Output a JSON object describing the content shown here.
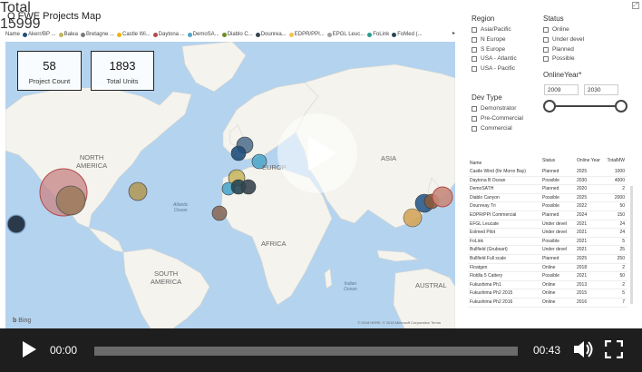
{
  "report": {
    "title": "Q FWE Projects Map",
    "legend_title": "Name",
    "legend_items": [
      {
        "label": "Akerr/BP ...",
        "color": "#1f4e79"
      },
      {
        "label": "Balea",
        "color": "#c5b45a"
      },
      {
        "label": "Bretagne ...",
        "color": "#7a7a7a"
      },
      {
        "label": "Castle Wi...",
        "color": "#f0b400"
      },
      {
        "label": "Daytona ...",
        "color": "#b34a4a"
      },
      {
        "label": "DemoSA...",
        "color": "#4da6c8"
      },
      {
        "label": "Diablo C...",
        "color": "#6b8e23"
      },
      {
        "label": "Dounrea...",
        "color": "#36454f"
      },
      {
        "label": "EDPR/PPI...",
        "color": "#f2c14e"
      },
      {
        "label": "EPGL Leuc...",
        "color": "#a0a0a0"
      },
      {
        "label": "FoLink",
        "color": "#2a9d8f"
      },
      {
        "label": "FoMed (...",
        "color": "#264653"
      }
    ],
    "legend_more": "▸"
  },
  "kpis": [
    {
      "value": "58",
      "label": "Project Count"
    },
    {
      "value": "1893",
      "label": "Total Units"
    }
  ],
  "map": {
    "labels": {
      "north_america": "NORTH\nAMERICA",
      "europe": "EUROP",
      "asia": "ASIA",
      "africa": "AFRICA",
      "south_america": "SOUTH\nAMERICA",
      "australia": "AUSTRAL"
    },
    "ocean_labels": {
      "atlantic": "Atlantic\nOcean",
      "indian": "Indian\nOcean"
    },
    "bing": "Bing",
    "attribution": "© 2018 HERE, © 2018 Microsoft Corporation Terms"
  },
  "filters": {
    "region_title": "Region",
    "regions": [
      "Asia/Pacific",
      "N Europe",
      "S Europe",
      "USA - Atlantic",
      "USA - Pacific"
    ],
    "status_title": "Status",
    "statuses": [
      "Online",
      "Under devel",
      "Planned",
      "Possible"
    ],
    "dev_type_title": "Dev Type",
    "dev_types": [
      "Demonstrator",
      "Pre-Commercial",
      "Commercial"
    ],
    "online_year_title": "OnlineYear*",
    "year_from": "2009",
    "year_to": "2030"
  },
  "table": {
    "columns": [
      "Name",
      "Status",
      "Online Year",
      "TotalMW"
    ],
    "rows": [
      [
        "Castle Wind (Ihr Morro Bay)",
        "Planned",
        "2025",
        "1000"
      ],
      [
        "Daytona B Ocean",
        "Possible",
        "2030",
        "4000"
      ],
      [
        "DemoSATH",
        "Planned",
        "2020",
        "2"
      ],
      [
        "Diablo Canyon",
        "Possible",
        "2025",
        "2000"
      ],
      [
        "Dounreay Tri",
        "Possible",
        "2022",
        "50"
      ],
      [
        "EDPR/PPI Commercial",
        "Planned",
        "2024",
        "150"
      ],
      [
        "EFGL Leucate",
        "Under devel",
        "2021",
        "24"
      ],
      [
        "Eolmed Pilot",
        "Under devel",
        "2021",
        "24"
      ],
      [
        "FoLink",
        "Possible",
        "2021",
        "5"
      ],
      [
        "Bullfield (Grubsart)",
        "Under devel",
        "2021",
        "25"
      ],
      [
        "Bullfield Full scale",
        "Planned",
        "2025",
        "250"
      ],
      [
        "Floatgen",
        "Online",
        "2018",
        "2"
      ],
      [
        "Flotilla 5 Cattery",
        "Possible",
        "2021",
        "50"
      ],
      [
        "Fukushima Ph1",
        "Online",
        "2013",
        "2"
      ],
      [
        "Fukushima Ph2 2015",
        "Online",
        "2015",
        "5"
      ],
      [
        "Fukushima Ph2 2016",
        "Online",
        "2016",
        "7"
      ]
    ],
    "total_label": "Total",
    "total_value": "15999"
  },
  "player": {
    "current_time": "00:00",
    "duration": "00:43",
    "progress": 0
  }
}
